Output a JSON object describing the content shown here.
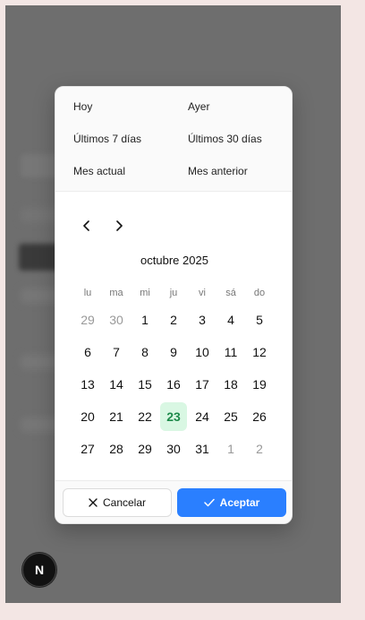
{
  "presets": [
    {
      "label": "Hoy"
    },
    {
      "label": "Ayer"
    },
    {
      "label": "Últimos 7 días"
    },
    {
      "label": "Últimos 30 días"
    },
    {
      "label": "Mes actual"
    },
    {
      "label": "Mes anterior"
    }
  ],
  "calendar": {
    "month_label": "octubre 2025",
    "weekdays": [
      "lu",
      "ma",
      "mi",
      "ju",
      "vi",
      "sá",
      "do"
    ],
    "weeks": [
      [
        {
          "d": "29",
          "m": true
        },
        {
          "d": "30",
          "m": true
        },
        {
          "d": "1"
        },
        {
          "d": "2"
        },
        {
          "d": "3"
        },
        {
          "d": "4"
        },
        {
          "d": "5"
        }
      ],
      [
        {
          "d": "6"
        },
        {
          "d": "7"
        },
        {
          "d": "8"
        },
        {
          "d": "9"
        },
        {
          "d": "10"
        },
        {
          "d": "11"
        },
        {
          "d": "12"
        }
      ],
      [
        {
          "d": "13"
        },
        {
          "d": "14"
        },
        {
          "d": "15"
        },
        {
          "d": "16"
        },
        {
          "d": "17"
        },
        {
          "d": "18"
        },
        {
          "d": "19"
        }
      ],
      [
        {
          "d": "20"
        },
        {
          "d": "21"
        },
        {
          "d": "22"
        },
        {
          "d": "23",
          "s": true
        },
        {
          "d": "24"
        },
        {
          "d": "25"
        },
        {
          "d": "26"
        }
      ],
      [
        {
          "d": "27"
        },
        {
          "d": "28"
        },
        {
          "d": "29"
        },
        {
          "d": "30"
        },
        {
          "d": "31"
        },
        {
          "d": "1",
          "m": true
        },
        {
          "d": "2",
          "m": true
        }
      ]
    ],
    "selected_day": "23"
  },
  "footer": {
    "cancel_label": "Cancelar",
    "accept_label": "Aceptar"
  },
  "badge": {
    "letter": "N"
  },
  "colors": {
    "accent": "#2a7fff",
    "selected_bg": "#d9f7e3",
    "selected_fg": "#1d8a4a",
    "backdrop": "#6e6e6e"
  },
  "icons": {
    "prev": "chevron-left-icon",
    "next": "chevron-right-icon",
    "cancel": "close-icon",
    "accept": "check-icon"
  }
}
